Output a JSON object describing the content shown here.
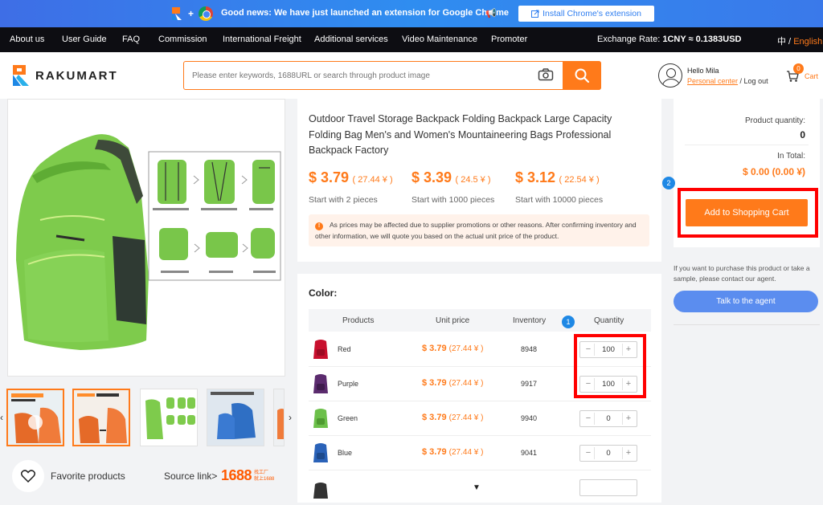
{
  "promo": {
    "text": "Good news: We have just launched an extension for Google Chrome",
    "button": "Install Chrome's extension"
  },
  "nav": {
    "items": [
      "About us",
      "User Guide",
      "FAQ",
      "Commission",
      "International Freight",
      "Additional services",
      "Video Maintenance",
      "Promoter"
    ],
    "exchange_label": "Exchange Rate: ",
    "exchange_value": "1CNY ≈ 0.1383USD",
    "lang_cn": "中 /",
    "lang_en": "English"
  },
  "header": {
    "brand": "RAKUMART",
    "search_placeholder": "Please enter keywords, 1688URL or search through product image",
    "hello": "Hello Mila",
    "personal_center": "Personal center",
    "logout": " / Log out",
    "cart_count": "0",
    "cart_label": "Cart"
  },
  "product": {
    "title": "Outdoor Travel Storage Backpack Folding Backpack Large Capacity Folding Bag Men's and Women's Mountaineering Bags Professional Backpack Factory",
    "prices": [
      {
        "usd": "$ 3.79",
        "cny": "( 27.44 ¥ )",
        "start": "Start with 2 pieces"
      },
      {
        "usd": "$ 3.39",
        "cny": "( 24.5 ¥ )",
        "start": "Start with 1000 pieces"
      },
      {
        "usd": "$ 3.12",
        "cny": "( 22.54 ¥ )",
        "start": "Start with 10000 pieces"
      }
    ],
    "notice": "As prices may be affected due to supplier promotions or other reasons. After confirming inventory and other information, we will quote you based on the actual unit price of the product."
  },
  "variants": {
    "label": "Color:",
    "headers": [
      "Products",
      "Unit price",
      "Inventory",
      "Quantity"
    ],
    "rows": [
      {
        "name": "Red",
        "usd": "$ 3.79",
        "cny": "(27.44 ¥ )",
        "inventory": "8948",
        "qty": "100",
        "color": "#c8102e"
      },
      {
        "name": "Purple",
        "usd": "$ 3.79",
        "cny": "(27.44 ¥ )",
        "inventory": "9917",
        "qty": "100",
        "color": "#5b2b6e"
      },
      {
        "name": "Green",
        "usd": "$ 3.79",
        "cny": "(27.44 ¥ )",
        "inventory": "9940",
        "qty": "0",
        "color": "#6cc04a"
      },
      {
        "name": "Blue",
        "usd": "$ 3.79",
        "cny": "(27.44 ¥ )",
        "inventory": "9041",
        "qty": "0",
        "color": "#2a62b8"
      }
    ]
  },
  "summary": {
    "qty_label": "Product quantity:",
    "qty_value": "0",
    "total_label": "In Total:",
    "total_value": "$ 0.00 (0.00 ¥)",
    "add_button": "Add to Shopping Cart",
    "contact_note": "If you want to purchase this product or take a sample, please contact our agent.",
    "talk_button": "Talk to the agent"
  },
  "badges": {
    "one": "1",
    "two": "2"
  },
  "footer": {
    "favorite": "Favorite products",
    "source": "Source link>",
    "logo_num": "1688",
    "logo_sub1": "找工厂",
    "logo_sub2": "就上1688"
  },
  "colors": {
    "accent": "#ff7a1a",
    "nav_bg": "#0d0d12",
    "promo_blue": "#2f8df0",
    "highlight": "#ff0000"
  }
}
